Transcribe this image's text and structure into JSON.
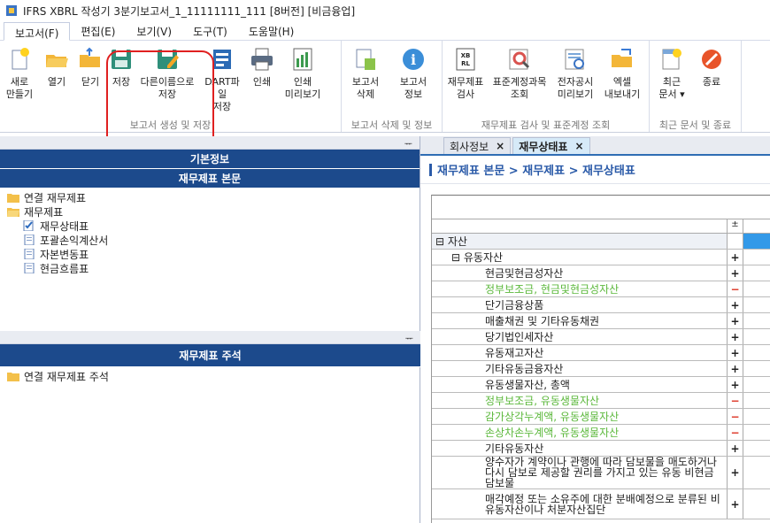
{
  "window": {
    "title": "IFRS XBRL 작성기 3분기보고서_1_11111111_111 [8버전] [비금융업]"
  },
  "menus": [
    "보고서(F)",
    "편집(E)",
    "보기(V)",
    "도구(T)",
    "도움말(H)"
  ],
  "ribbon": {
    "groups": [
      {
        "label": "보고서 생성 및 저장",
        "buttons": [
          {
            "label": "새로\n만들기",
            "icon": "new-file-icon"
          },
          {
            "label": "열기",
            "icon": "open-folder-icon"
          },
          {
            "label": "닫기",
            "icon": "close-folder-icon"
          },
          {
            "label": "저장",
            "icon": "save-icon"
          },
          {
            "label": "다른이름으로\n저장",
            "icon": "save-as-icon"
          },
          {
            "label": "DART파일\n저장",
            "icon": "dart-save-icon"
          },
          {
            "label": "인쇄",
            "icon": "print-icon"
          },
          {
            "label": "인쇄\n미리보기",
            "icon": "print-preview-icon"
          }
        ]
      },
      {
        "label": "보고서 삭제 및 정보",
        "buttons": [
          {
            "label": "보고서\n삭제",
            "icon": "delete-report-icon"
          },
          {
            "label": "보고서\n정보",
            "icon": "info-icon"
          }
        ]
      },
      {
        "label": "재무제표 검사 및 표준계정 조회",
        "buttons": [
          {
            "label": "재무제표\n검사",
            "icon": "xbrl-check-icon"
          },
          {
            "label": "표준계정과목\n조회",
            "icon": "account-search-icon"
          },
          {
            "label": "전자공시\n미리보기",
            "icon": "disclosure-preview-icon"
          },
          {
            "label": "엑셀\n내보내기",
            "icon": "excel-export-icon"
          }
        ]
      },
      {
        "label": "최근 문서 및 종료",
        "buttons": [
          {
            "label": "최근\n문서 ▾",
            "icon": "recent-docs-icon"
          },
          {
            "label": "종료",
            "icon": "exit-icon"
          }
        ]
      }
    ]
  },
  "left": {
    "basic_info": "기본정보",
    "fs_main": "재무제표 본문",
    "tree": [
      {
        "label": "연결 재무제표",
        "level": 0,
        "icon": "folder-icon"
      },
      {
        "label": "재무제표",
        "level": 0,
        "icon": "folder-open-icon"
      },
      {
        "label": "재무상태표",
        "level": 1,
        "icon": "checked-doc-icon"
      },
      {
        "label": "포괄손익계산서",
        "level": 1,
        "icon": "document-icon"
      },
      {
        "label": "자본변동표",
        "level": 1,
        "icon": "document-icon"
      },
      {
        "label": "현금흐름표",
        "level": 1,
        "icon": "document-icon"
      }
    ],
    "notes_title": "재무제표 주석",
    "notes_tree": [
      {
        "label": "연결 재무제표 주석",
        "icon": "folder-icon"
      }
    ],
    "pin": "ᅲ"
  },
  "right": {
    "tabs": [
      {
        "label": "회사정보",
        "close": "×"
      },
      {
        "label": "재무상태표",
        "close": "×"
      }
    ],
    "breadcrumb": "재무제표 본문 > 재무제표 > 재무상태표",
    "header_sign": "±",
    "rows": [
      {
        "label": "⊟ 자산",
        "indent": 0,
        "sign": "",
        "green": false
      },
      {
        "label": "⊟ 유동자산",
        "indent": 1,
        "sign": "+",
        "green": false
      },
      {
        "label": "현금및현금성자산",
        "indent": 2,
        "sign": "+",
        "green": false
      },
      {
        "label": "정부보조금, 현금및현금성자산",
        "indent": 2,
        "sign": "−",
        "green": true
      },
      {
        "label": "단기금융상품",
        "indent": 2,
        "sign": "+",
        "green": false
      },
      {
        "label": "매출채권 및 기타유동채권",
        "indent": 2,
        "sign": "+",
        "green": false
      },
      {
        "label": "당기법인세자산",
        "indent": 2,
        "sign": "+",
        "green": false
      },
      {
        "label": "유동재고자산",
        "indent": 2,
        "sign": "+",
        "green": false
      },
      {
        "label": "기타유동금융자산",
        "indent": 2,
        "sign": "+",
        "green": false
      },
      {
        "label": "유동생물자산, 총액",
        "indent": 2,
        "sign": "+",
        "green": false
      },
      {
        "label": "정부보조금, 유동생물자산",
        "indent": 2,
        "sign": "−",
        "green": true
      },
      {
        "label": "감가상각누계액, 유동생물자산",
        "indent": 2,
        "sign": "−",
        "green": true
      },
      {
        "label": "손상차손누계액, 유동생물자산",
        "indent": 2,
        "sign": "−",
        "green": true
      },
      {
        "label": "기타유동자산",
        "indent": 2,
        "sign": "+",
        "green": false
      },
      {
        "label": "양수자가 계약이나 관행에 따라 담보물을 매도하거나 다시 담보로 제공할 권리를 가지고 있는 유동 비현금담보물",
        "indent": 2,
        "sign": "+",
        "green": false
      },
      {
        "label": "매각예정 또는 소유주에 대한 분배예정으로 분류된 비유동자산이나 처분자산집단",
        "indent": 2,
        "sign": "+",
        "green": false
      }
    ]
  }
}
